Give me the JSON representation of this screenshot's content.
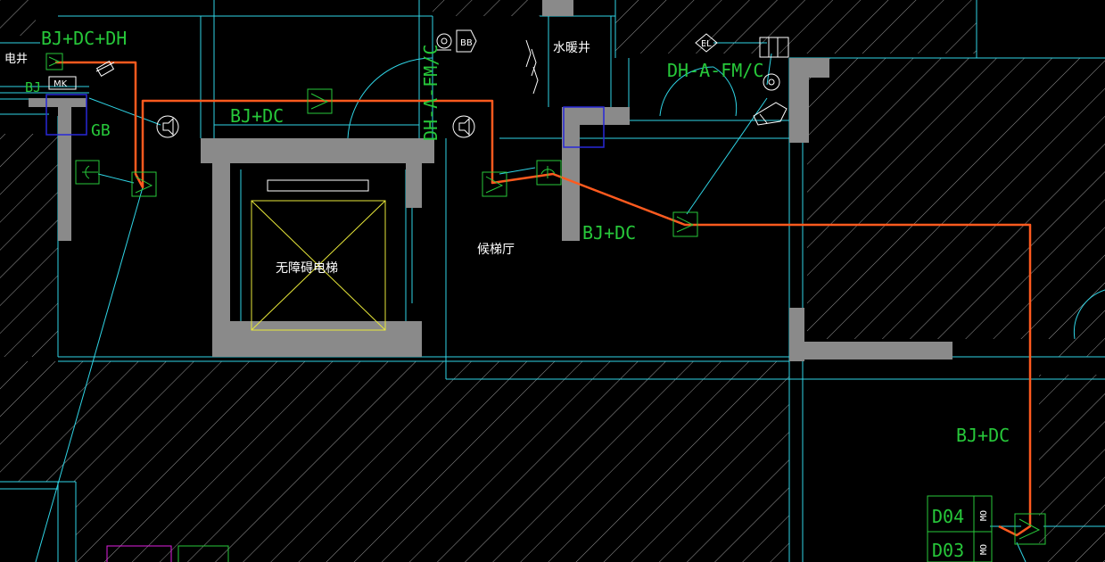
{
  "drawing": {
    "colors": {
      "background": "#000000",
      "wall_line": "#2fd5e6",
      "wall_fill": "#8a8a8a",
      "hatch": "#c8c8c8",
      "annotation": "#27c83a",
      "route": "#ff5a1e",
      "room_text": "#ffffff",
      "elevator_cross": "#e8e83a",
      "blue_box": "#2828d8",
      "magenta": "#e020e0"
    },
    "labels": {
      "bj_dc_dh": "BJ+DC+DH",
      "electric_shaft": "电井",
      "bj": "BJ",
      "mk": "MK",
      "gb": "GB",
      "bj_dc_top": "BJ+DC",
      "dh_a_fm_c_vertical": "DH-A-FM/C",
      "water_heating_shaft": "水暖井",
      "dh_a_fm_c_horizontal": "DH-A-FM/C",
      "el": "EL",
      "bj_dc_mid": "BJ+DC",
      "elevator_lobby": "候梯厅",
      "accessible_elevator": "无障碍电梯",
      "bj_dc_right": "BJ+DC",
      "d04": "D04",
      "d03": "D03",
      "mo_top": "MO",
      "mo_bottom": "MO"
    },
    "icons": [
      "detector-icon",
      "speaker-icon",
      "handset-icon",
      "camera-icon",
      "fan-icon",
      "telephone-icon"
    ]
  }
}
